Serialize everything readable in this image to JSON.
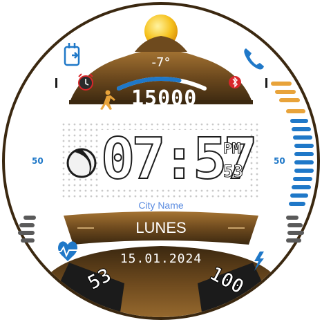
{
  "weather": {
    "temperature": "-7°",
    "icon": "sun-icon"
  },
  "steps": {
    "count": "15000",
    "progress": 0.7,
    "icon": "walking-person-icon"
  },
  "time": {
    "hhmm": "07:57",
    "ampm": "PM",
    "seconds": "53"
  },
  "side_labels": {
    "left": "50",
    "right": "50"
  },
  "location": {
    "city": "City Name"
  },
  "date": {
    "weekday": "LUNES",
    "full": "15.01.2024"
  },
  "heart_rate": {
    "value": "53",
    "icon": "heart-rate-icon"
  },
  "battery": {
    "value": "100",
    "icon": "lightning-icon"
  },
  "shortcuts": {
    "left_top": "calendar-icon",
    "right_top": "phone-icon",
    "alarm": "alarm-clock-icon",
    "bluetooth": "bluetooth-icon",
    "moon": "moon-phase-icon"
  },
  "colors": {
    "brown_dark": "#3b2810",
    "brown_mid": "#7a5424",
    "accent_blue": "#1f78c8",
    "accent_orange": "#e8a33a",
    "red": "#d8262a"
  }
}
